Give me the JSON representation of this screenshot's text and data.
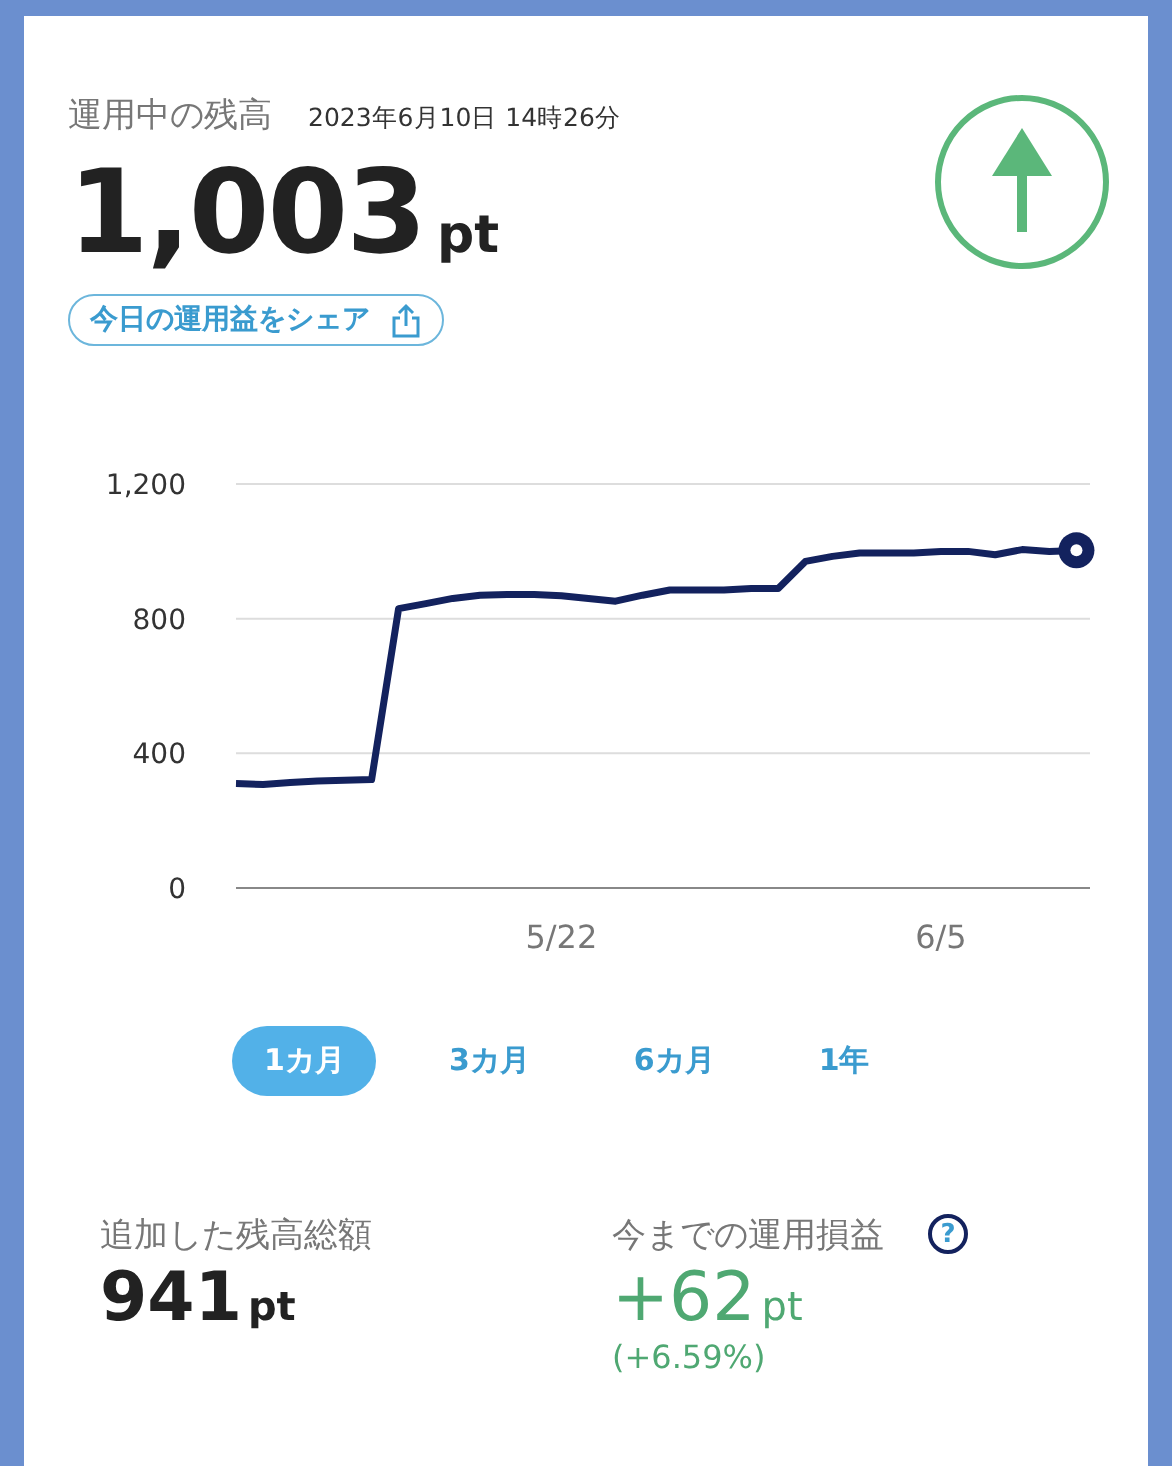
{
  "header": {
    "title": "運用中の残高",
    "timestamp": "2023年6月10日 14時26分"
  },
  "balance": {
    "amount": "1,003",
    "unit": "pt",
    "rising": true
  },
  "share_button": {
    "label": "今日の運用益をシェア"
  },
  "chart_data": {
    "type": "line",
    "categories": [
      null,
      null,
      null,
      null,
      null,
      null,
      null,
      null,
      null,
      null,
      null,
      null,
      "5/22",
      null,
      null,
      null,
      null,
      null,
      null,
      null,
      null,
      null,
      null,
      null,
      null,
      null,
      "6/5",
      null,
      null,
      null,
      null,
      null
    ],
    "series": [
      {
        "color": "#13225e",
        "values": [
          310,
          308,
          313,
          318,
          320,
          322,
          830,
          845,
          860,
          870,
          872,
          872,
          868,
          860,
          852,
          870,
          885,
          885,
          885,
          890,
          890,
          970,
          985,
          995,
          995,
          995,
          1000,
          1000,
          990,
          1005,
          1000,
          1003
        ]
      }
    ],
    "ylim": [
      0,
      1200
    ],
    "yticks": [
      {
        "value": 0,
        "label": "0"
      },
      {
        "value": 400,
        "label": "400"
      },
      {
        "value": 800,
        "label": "800"
      },
      {
        "value": 1200,
        "label": "1,200"
      }
    ]
  },
  "periods": [
    {
      "label": "1カ月",
      "selected": true
    },
    {
      "label": "3カ月",
      "selected": false
    },
    {
      "label": "6カ月",
      "selected": false
    },
    {
      "label": "1年",
      "selected": false
    }
  ],
  "stats": [
    {
      "label": "追加した残高総額",
      "value": "941",
      "unit": "pt",
      "kind": "plain"
    },
    {
      "label": "今までの運用損益",
      "value": "+62",
      "unit": "pt",
      "change": "(+6.59%)",
      "kind": "gain",
      "help": "?"
    }
  ]
}
